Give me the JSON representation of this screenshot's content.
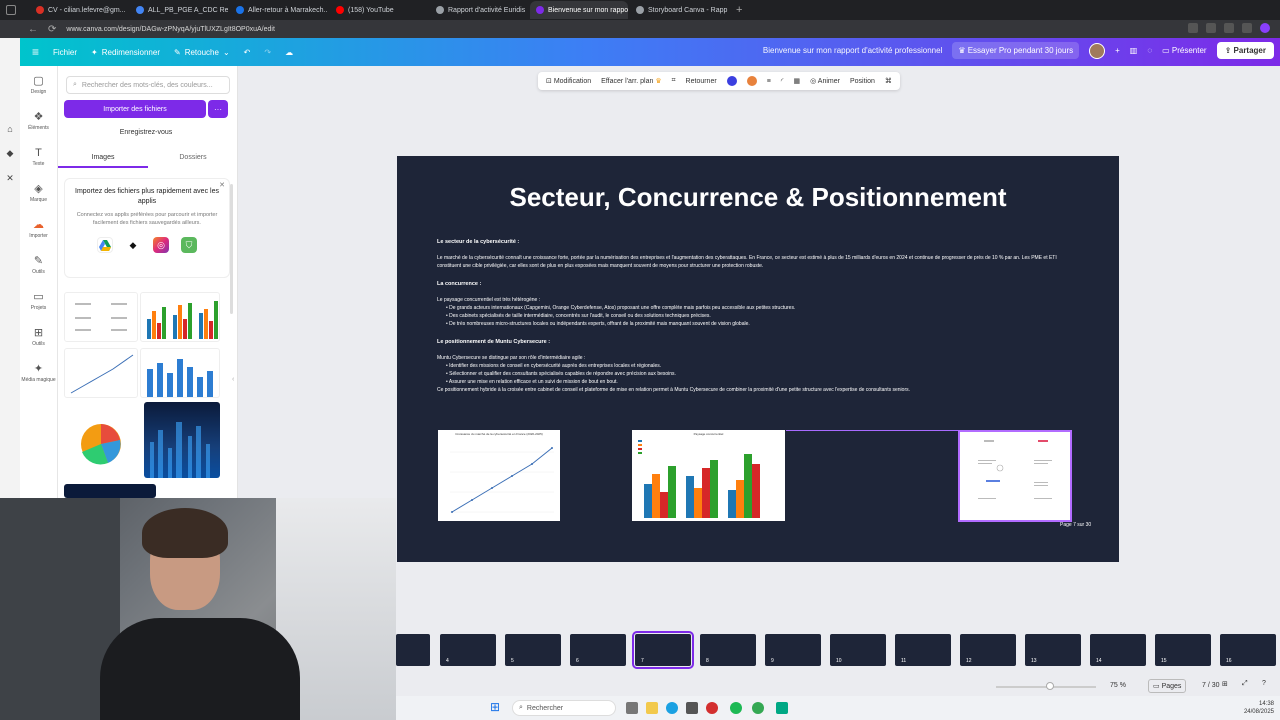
{
  "browser": {
    "tabs": [
      {
        "label": "CV - cilian.lefevre@gm...",
        "color": "#d93025",
        "active": false
      },
      {
        "label": "ALL_PB_PGE A_CDC Re...",
        "color": "#4285f4",
        "active": false
      },
      {
        "label": "Aller-retour à Marrakech...",
        "color": "#1a73e8",
        "active": false
      },
      {
        "label": "(158) YouTube",
        "color": "#ff0000",
        "active": false
      },
      {
        "label": "Rapport d'activité Euridis",
        "color": "#9aa0a6",
        "active": false
      },
      {
        "label": "Bienvenue sur mon rappo...",
        "color": "#7d2ae8",
        "active": true
      },
      {
        "label": "Storyboard Canva - Rapp...",
        "color": "#9aa0a6",
        "active": false
      }
    ],
    "url": "www.canva.com/design/DAGw-zPNyqA/yjuTlUXZLgIt8OP0xuA/edit"
  },
  "topbar": {
    "file": "Fichier",
    "resize": "Redimensionner",
    "edit": "Retouche",
    "doc_title": "Bienvenue sur mon rapport d'activité professionnel",
    "pro": "Essayer Pro pendant 30 jours",
    "present": "Présenter",
    "share": "Partager"
  },
  "rail": [
    {
      "label": "Design",
      "icon": "▢"
    },
    {
      "label": "Éléments",
      "icon": "❖"
    },
    {
      "label": "Texte",
      "icon": "T"
    },
    {
      "label": "Marque",
      "icon": "◈"
    },
    {
      "label": "Importer",
      "icon": "☁"
    },
    {
      "label": "Outils",
      "icon": "✎"
    },
    {
      "label": "Projets",
      "icon": "▭"
    },
    {
      "label": "Outils",
      "icon": "⊞"
    },
    {
      "label": "Média magique",
      "icon": "✦"
    }
  ],
  "panel": {
    "search_placeholder": "Rechercher des mots-clés, des couleurs...",
    "import_btn": "Importer des fichiers",
    "more_btn": "···",
    "record_btn": "Enregistrez-vous",
    "tab_images": "Images",
    "tab_folders": "Dossiers",
    "promo_title": "Importez des fichiers plus rapidement avec les applis",
    "promo_text": "Connectez vos applis préférées pour parcourir et importer facilement des fichiers sauvegardés ailleurs."
  },
  "toolbar": {
    "edit": "Modification",
    "erase_bg": "Effacer l'arr. plan",
    "flip": "Retourner",
    "animate": "Animer",
    "position": "Position"
  },
  "slide": {
    "title": "Secteur, Concurrence & Positionnement",
    "section1_h": "Le secteur de la cybersécurité :",
    "section1_p": "Le marché de la cybersécurité connaît une croissance forte, portée par la numérisation des entreprises et l'augmentation des cyberattaques. En France, ce secteur est estimé à plus de 15 milliards d'euros en 2024 et continue de progresser de près de 10 % par an. Les PME et ETI constituent une cible privilégiée, car elles sont de plus en plus exposées mais manquent souvent de moyens pour structurer une protection robuste.",
    "section2_h": "La concurrence :",
    "section2_intro": "Le paysage concurrentiel est très hétérogène :",
    "section2_items": [
      "De grands acteurs internationaux (Capgemini, Orange Cyberdefense, Atos) proposant une offre complète mais parfois peu accessible aux petites structures.",
      "Des cabinets spécialisés de taille intermédiaire, concentrés sur l'audit, le conseil ou des solutions techniques précises.",
      "De très nombreuses micro-structures locales ou indépendants experts, offrant de la proximité mais manquant souvent de vision globale."
    ],
    "section3_h": "Le positionnement de Muntu Cybersecure :",
    "section3_intro": "Muntu Cybersecure se distingue par son rôle d'intermédiaire agile :",
    "section3_items": [
      "Identifier des missions de conseil en cybersécurité auprès des entreprises locales et régionales.",
      "Sélectionner et qualifier des consultants spécialisés capables de répondre avec précision aux besoins.",
      "Assurer une mise en relation efficace et un suivi de mission de bout en bout."
    ],
    "section3_outro": "Ce positionnement hybride à la croisée entre cabinet de conseil et plateforme de mise en relation permet à Muntu Cybersecure de combiner la proximité d'une petite structure avec l'expertise de consultants seniors.",
    "img1_caption": "Croissance du marché de la cybersécurité en France (2020-2025)",
    "img2_caption": "Paysage concurrentiel",
    "page_label": "Page 7 sur 30"
  },
  "filmstrip": {
    "pages": [
      "4",
      "5",
      "6",
      "7",
      "8",
      "9",
      "10",
      "11",
      "12",
      "13",
      "14",
      "15",
      "16"
    ],
    "active": "7"
  },
  "status": {
    "zoom": "75 %",
    "pages_btn": "Pages",
    "page_count": "7 / 30"
  },
  "taskbar": {
    "search": "Rechercher",
    "time": "14:38",
    "date": "24/08/2025"
  }
}
